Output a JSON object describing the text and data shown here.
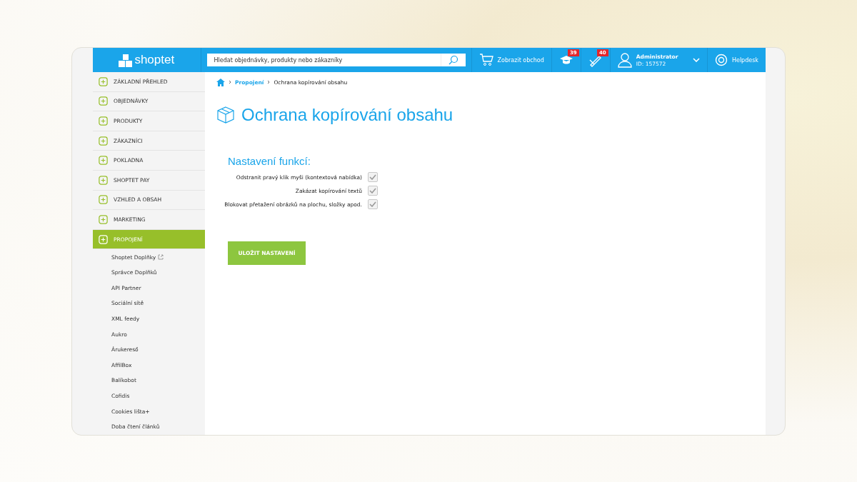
{
  "header": {
    "logo": "shoptet",
    "search_placeholder": "Hledat objednávky, produkty nebo zákazníky",
    "shop_link": "Zobrazit obchod",
    "badges": [
      {
        "count": "39"
      },
      {
        "count": "40"
      }
    ],
    "user": {
      "name": "Administrator",
      "id": "ID: 157572"
    },
    "help": "Helpdesk"
  },
  "sidebar": {
    "items": [
      {
        "label": "ZÁKLADNÍ PŘEHLED",
        "selected": false
      },
      {
        "label": "OBJEDNÁVKY",
        "selected": false
      },
      {
        "label": "PRODUKTY",
        "selected": false
      },
      {
        "label": "ZÁKAZNÍCI",
        "selected": false
      },
      {
        "label": "POKLADNA",
        "selected": false
      },
      {
        "label": "SHOPTET PAY",
        "selected": false
      },
      {
        "label": "VZHLED A OBSAH",
        "selected": false
      },
      {
        "label": "MARKETING",
        "selected": false
      },
      {
        "label": "PROPOJENÍ",
        "selected": true
      }
    ],
    "subitems": [
      {
        "label": "Shoptet Doplňky",
        "external": true
      },
      {
        "label": "Správce Doplňků",
        "external": false
      },
      {
        "label": "API Partner",
        "external": false
      },
      {
        "label": "Sociální sítě",
        "external": false
      },
      {
        "label": "XML feedy",
        "external": false
      },
      {
        "label": "Aukro",
        "external": false
      },
      {
        "label": "Árukereső",
        "external": false
      },
      {
        "label": "AffilBox",
        "external": false
      },
      {
        "label": "Balíkobot",
        "external": false
      },
      {
        "label": "Cofidis",
        "external": false
      },
      {
        "label": "Cookies lišta+",
        "external": false
      },
      {
        "label": "Doba čtení článků",
        "external": false
      }
    ]
  },
  "breadcrumb": [
    {
      "label": "Propojení"
    },
    {
      "label": "Ochrana kopírování obsahu"
    }
  ],
  "page_title": "Ochrana kopírování obsahu",
  "section_title": "Nastavení funkcí:",
  "options": [
    {
      "label": "Odstranit pravý klik myši (kontextová nabídka)",
      "checked": true
    },
    {
      "label": "Zakázat kopírování textů",
      "checked": true
    },
    {
      "label": "Blokovat přetažení obrázků na plochu, složky apod.",
      "checked": true
    }
  ],
  "save_button": "ULOŽIT NASTAVENÍ"
}
